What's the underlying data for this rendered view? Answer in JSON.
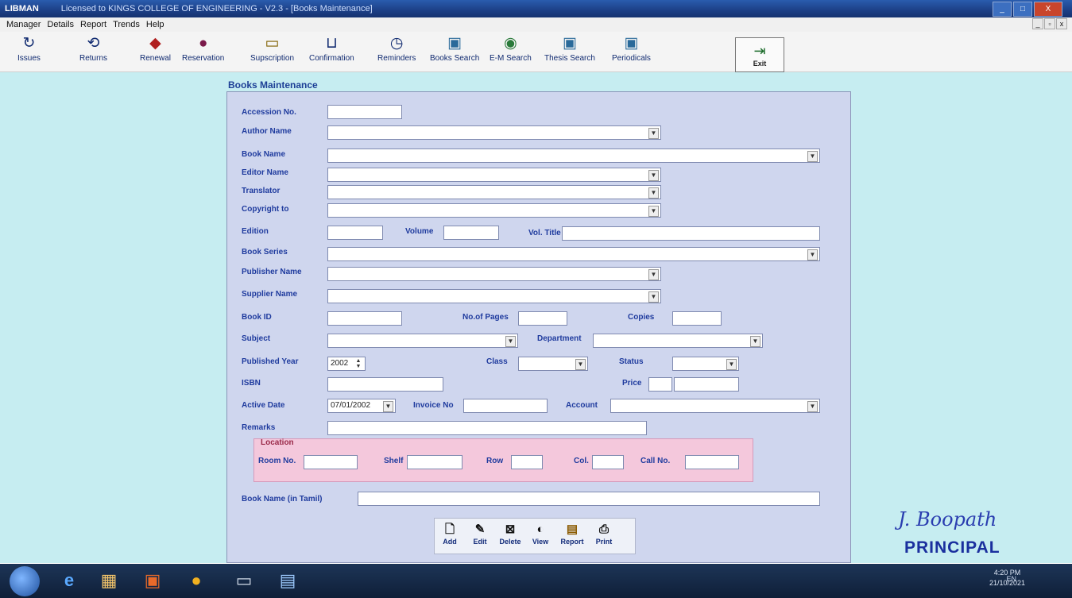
{
  "window": {
    "app_name": "LIBMAN",
    "title": "Licensed to KINGS COLLEGE OF ENGINEERING - V2.3 - [Books Maintenance]",
    "controls": [
      "_",
      "□",
      "X"
    ]
  },
  "menu": {
    "items": [
      "Manager",
      "Details",
      "Report",
      "Trends",
      "Help"
    ],
    "mdi_controls": [
      "_",
      "▫",
      "x"
    ]
  },
  "toolbar": {
    "buttons": [
      {
        "label": "Issues",
        "icon": "issues-icon",
        "glyph": "↻"
      },
      {
        "label": "Returns",
        "icon": "returns-icon",
        "glyph": "⟲"
      },
      {
        "label": "Renewal",
        "icon": "renewal-icon",
        "glyph": "◆"
      },
      {
        "label": "Reservation",
        "icon": "reservation-icon",
        "glyph": "●"
      },
      {
        "label": "Supscription",
        "icon": "subscription-icon",
        "glyph": "▭"
      },
      {
        "label": "Confirmation",
        "icon": "confirmation-icon",
        "glyph": "⊔"
      },
      {
        "label": "Reminders",
        "icon": "reminders-icon",
        "glyph": "◷"
      },
      {
        "label": "Books Search",
        "icon": "books-search-icon",
        "glyph": "▣"
      },
      {
        "label": "E-M Search",
        "icon": "em-search-icon",
        "glyph": "◉"
      },
      {
        "label": "Thesis Search",
        "icon": "thesis-search-icon",
        "glyph": "▣"
      },
      {
        "label": "Periodicals",
        "icon": "periodicals-icon",
        "glyph": "▣"
      }
    ],
    "exit": {
      "label": "Exit",
      "icon": "exit-icon",
      "glyph": "⇥"
    }
  },
  "form": {
    "title": "Books Maintenance",
    "labels": {
      "accession_no": "Accession No.",
      "author_name": "Author Name",
      "book_name": "Book Name",
      "editor_name": "Editor Name",
      "translator": "Translator",
      "copyright_to": "Copyright to",
      "edition": "Edition",
      "volume": "Volume",
      "vol_title": "Vol. Title",
      "book_series": "Book Series",
      "publisher_name": "Publisher Name",
      "supplier_name": "Supplier Name",
      "book_id": "Book ID",
      "no_of_pages": "No.of Pages",
      "copies": "Copies",
      "subject": "Subject",
      "department": "Department",
      "published_year": "Published Year",
      "class": "Class",
      "status": "Status",
      "isbn": "ISBN",
      "price": "Price",
      "active_date": "Active Date",
      "invoice_no": "Invoice No",
      "account": "Account",
      "remarks": "Remarks",
      "book_name_tamil": "Book Name (in Tamil)"
    },
    "values": {
      "published_year": "2002",
      "active_date": "07/01/2002"
    },
    "location": {
      "legend": "Location",
      "room_no": "Room No.",
      "shelf": "Shelf",
      "row": "Row",
      "col": "Col.",
      "call_no": "Call No."
    },
    "buttons": [
      {
        "label": "Add",
        "icon": "add-icon",
        "glyph": "🗋"
      },
      {
        "label": "Edit",
        "icon": "edit-icon",
        "glyph": "✎"
      },
      {
        "label": "Delete",
        "icon": "delete-icon",
        "glyph": "⊠"
      },
      {
        "label": "View",
        "icon": "view-icon",
        "glyph": "◐"
      },
      {
        "label": "Report",
        "icon": "report-icon",
        "glyph": "▤"
      },
      {
        "label": "Print",
        "icon": "print-icon",
        "glyph": "⎙"
      }
    ]
  },
  "annotation": {
    "signature": "J. Boopath",
    "stamp": "PRINCIPAL"
  },
  "taskbar": {
    "tray": "EN",
    "time": "4:20 PM",
    "date": "21/10/2021"
  }
}
